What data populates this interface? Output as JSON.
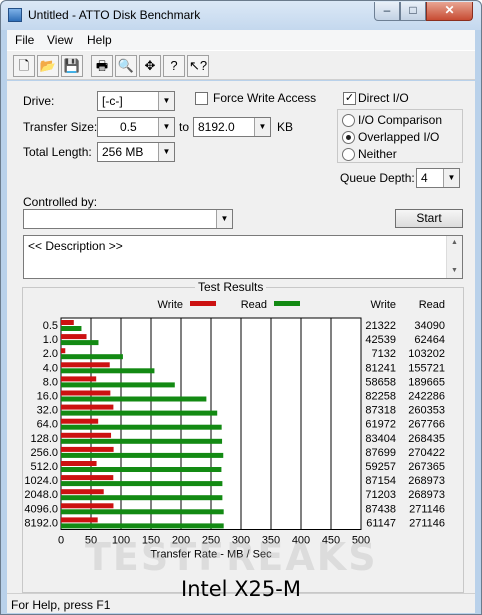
{
  "window": {
    "title": "Untitled - ATTO Disk Benchmark",
    "minimize": "–",
    "maximize": "□",
    "close": "✕"
  },
  "menu": [
    "File",
    "View",
    "Help"
  ],
  "toolbar": [
    {
      "name": "new-icon",
      "glyph": "🗋"
    },
    {
      "name": "open-icon",
      "glyph": "📂"
    },
    {
      "name": "save-icon",
      "glyph": "💾"
    },
    {
      "name": "print-icon",
      "glyph": "🖶"
    },
    {
      "name": "print-preview-icon",
      "glyph": "🔍"
    },
    {
      "name": "move-icon",
      "glyph": "✥"
    },
    {
      "name": "help-icon",
      "glyph": "?"
    },
    {
      "name": "context-help-icon",
      "glyph": "↖?"
    }
  ],
  "form": {
    "drive_label": "Drive:",
    "drive_value": "[-c-]",
    "force_write_label": "Force Write Access",
    "force_write_checked": false,
    "direct_io_label": "Direct I/O",
    "direct_io_checked": true,
    "transfer_label": "Transfer Size:",
    "transfer_from": "0.5",
    "transfer_to_label": "to",
    "transfer_to": "8192.0",
    "transfer_unit": "KB",
    "io_comparison_label": "I/O Comparison",
    "overlapped_label": "Overlapped I/O",
    "neither_label": "Neither",
    "selected_mode": "Overlapped I/O",
    "total_length_label": "Total Length:",
    "total_length_value": "256 MB",
    "queue_depth_label": "Queue Depth:",
    "queue_depth_value": "4",
    "controlled_by_label": "Controlled by:",
    "controlled_by_value": "",
    "start_label": "Start",
    "description": "<< Description >>"
  },
  "chart_data": {
    "type": "bar",
    "title": "Test Results",
    "xlabel": "Transfer Rate - MB / Sec",
    "xlim": [
      0,
      500
    ],
    "xticks": [
      0,
      50,
      100,
      150,
      200,
      250,
      300,
      350,
      400,
      450,
      500
    ],
    "categories": [
      "0.5",
      "1.0",
      "2.0",
      "4.0",
      "8.0",
      "16.0",
      "32.0",
      "64.0",
      "128.0",
      "256.0",
      "512.0",
      "1024.0",
      "2048.0",
      "4096.0",
      "8192.0"
    ],
    "series": [
      {
        "name": "Write",
        "color": "#cc1111",
        "values": [
          21322,
          42539,
          7132,
          81241,
          58658,
          82258,
          87318,
          61972,
          83404,
          87699,
          59257,
          87154,
          71203,
          87438,
          61147
        ]
      },
      {
        "name": "Read",
        "color": "#138a13",
        "values": [
          34090,
          62464,
          103202,
          155721,
          189665,
          242286,
          260353,
          267766,
          268435,
          270422,
          267365,
          268973,
          268973,
          271146,
          271146
        ]
      }
    ],
    "value_unit_divisor": 1000,
    "table_headers": [
      "Write",
      "Read"
    ],
    "legend": [
      "Write",
      "Read"
    ]
  },
  "status": "For Help, press F1",
  "caption": "Intel X25-M",
  "watermark": "TESTFREAKS"
}
